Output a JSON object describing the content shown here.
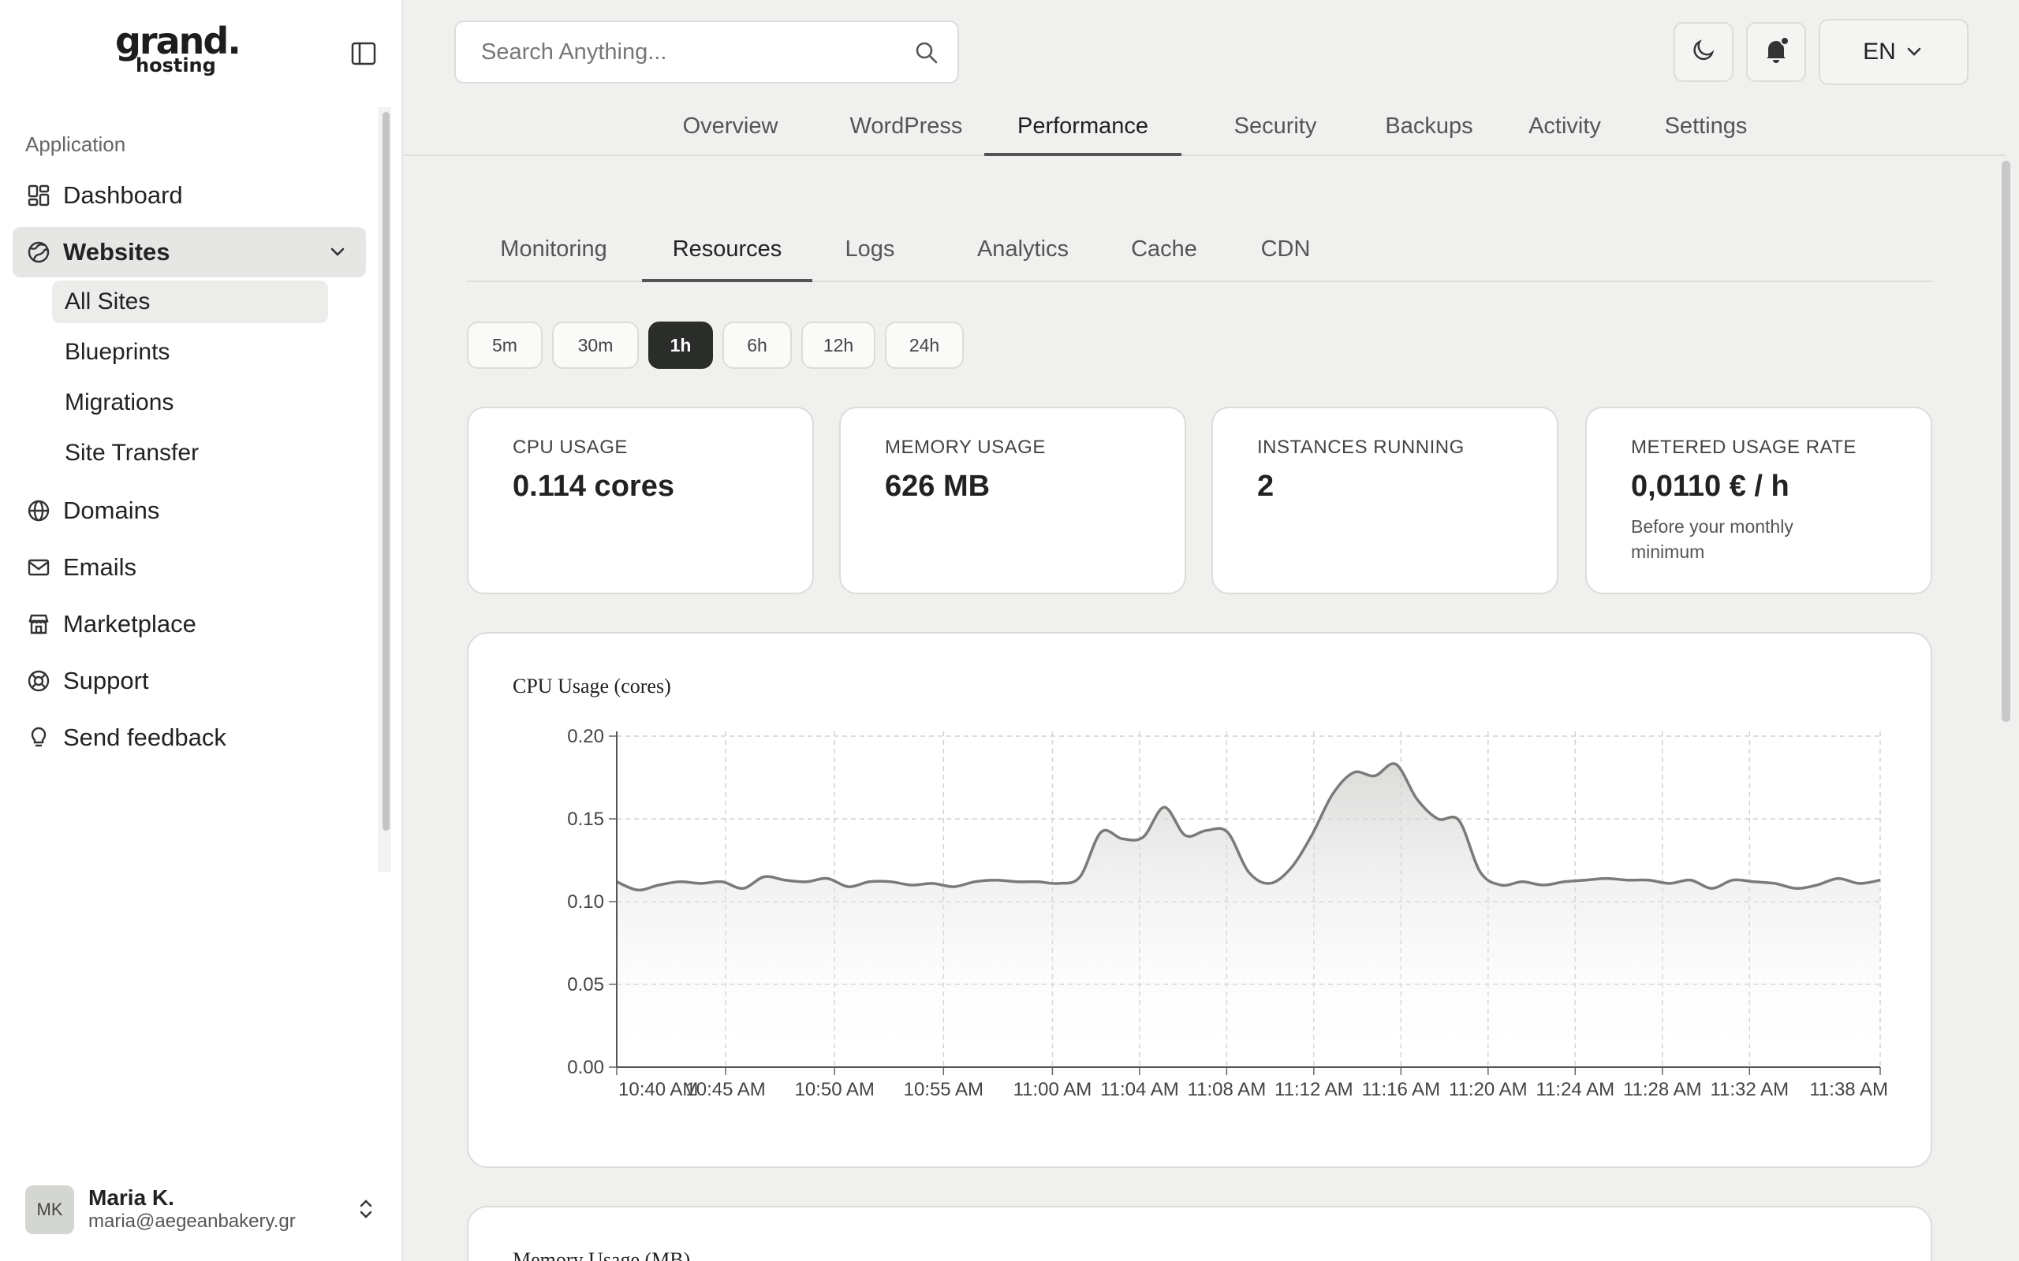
{
  "brand": {
    "line1": "grand.",
    "line2": "hosting"
  },
  "sidebar": {
    "section_label": "Application",
    "items": [
      {
        "label": "Dashboard",
        "icon": "dashboard-icon"
      },
      {
        "label": "Websites",
        "icon": "websites-icon",
        "active": true
      },
      {
        "label": "Domains",
        "icon": "globe-icon"
      },
      {
        "label": "Emails",
        "icon": "mail-icon"
      },
      {
        "label": "Marketplace",
        "icon": "store-icon"
      },
      {
        "label": "Support",
        "icon": "lifebuoy-icon"
      },
      {
        "label": "Send feedback",
        "icon": "lightbulb-icon"
      }
    ],
    "sub_items": [
      "All Sites",
      "Blueprints",
      "Migrations",
      "Site Transfer"
    ]
  },
  "user": {
    "initials": "MK",
    "name": "Maria K.",
    "email": "maria@aegeanbakery.gr"
  },
  "search": {
    "placeholder": "Search Anything..."
  },
  "header": {
    "language": "EN"
  },
  "main_tabs": [
    "Overview",
    "WordPress",
    "Performance",
    "Security",
    "Backups",
    "Activity",
    "Settings"
  ],
  "main_tab_active": "Performance",
  "sub_tabs": [
    "Monitoring",
    "Resources",
    "Logs",
    "Analytics",
    "Cache",
    "CDN"
  ],
  "sub_tab_active": "Resources",
  "time_ranges": [
    "5m",
    "30m",
    "1h",
    "6h",
    "12h",
    "24h"
  ],
  "time_range_active": "1h",
  "stats": [
    {
      "label": "CPU USAGE",
      "value": "0.114 cores"
    },
    {
      "label": "MEMORY USAGE",
      "value": "626 MB"
    },
    {
      "label": "INSTANCES RUNNING",
      "value": "2"
    },
    {
      "label": "METERED USAGE RATE",
      "value": "0,0110 € / h",
      "note": "Before your monthly minimum"
    }
  ],
  "colors": {
    "accent_dark": "#2a2d29",
    "line": "#7a7a78",
    "bg": "#f0f0ee"
  },
  "chart_data": [
    {
      "type": "area",
      "title": "CPU Usage (cores)",
      "ylim": [
        0,
        0.2
      ],
      "yticks": [
        "0.00",
        "0.05",
        "0.10",
        "0.15",
        "0.20"
      ],
      "xticks": [
        "10:40 AM",
        "10:45 AM",
        "10:50 AM",
        "10:55 AM",
        "11:00 AM",
        "11:04 AM",
        "11:08 AM",
        "11:12 AM",
        "11:16 AM",
        "11:20 AM",
        "11:24 AM",
        "11:28 AM",
        "11:32 AM",
        "11:38 AM"
      ],
      "grid": true,
      "x_minutes": [
        0,
        1,
        2,
        3,
        4,
        5,
        6,
        7,
        8,
        9,
        10,
        11,
        12,
        13,
        14,
        15,
        16,
        17,
        18,
        19,
        20,
        21,
        22,
        23,
        24,
        25,
        26,
        27,
        28,
        29,
        30,
        31,
        32,
        33,
        34,
        35,
        36,
        37,
        38,
        39,
        40,
        41,
        42,
        43,
        44,
        45,
        46,
        47,
        48,
        49,
        50,
        51,
        52,
        53,
        54,
        55,
        56,
        57,
        58,
        59,
        60
      ],
      "values": [
        0.112,
        0.107,
        0.11,
        0.112,
        0.111,
        0.112,
        0.108,
        0.115,
        0.113,
        0.112,
        0.114,
        0.109,
        0.112,
        0.112,
        0.11,
        0.111,
        0.109,
        0.112,
        0.113,
        0.112,
        0.112,
        0.111,
        0.115,
        0.142,
        0.138,
        0.139,
        0.157,
        0.14,
        0.143,
        0.142,
        0.118,
        0.111,
        0.12,
        0.14,
        0.165,
        0.178,
        0.176,
        0.183,
        0.162,
        0.15,
        0.149,
        0.118,
        0.11,
        0.112,
        0.11,
        0.112,
        0.113,
        0.114,
        0.113,
        0.113,
        0.111,
        0.113,
        0.108,
        0.113,
        0.112,
        0.111,
        0.108,
        0.11,
        0.114,
        0.111,
        0.113
      ]
    },
    {
      "type": "area",
      "title": "Memory Usage (MB)"
    }
  ]
}
